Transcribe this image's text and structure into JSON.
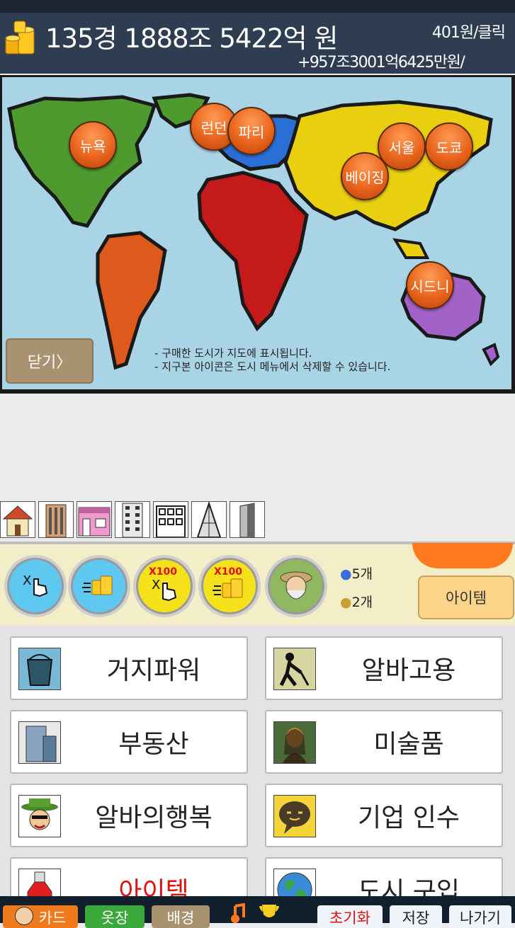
{
  "header": {
    "money": "135경 1888조 5422억 원",
    "per_click": "401원/클릭",
    "per_second": "+957조3001억6425만원/"
  },
  "map": {
    "cities": [
      "뉴욕",
      "런던",
      "파리",
      "서울",
      "도쿄",
      "베이징",
      "시드니"
    ],
    "close_label": "닫기〉",
    "hint_lines": [
      "- 구매한 도시가 지도에 표시됩니다.",
      "- 지구본 아이콘은 도시 메뉴에서 삭제할 수 있습니다."
    ]
  },
  "tools": {
    "x100_a": "X100",
    "x100_b": "X100",
    "potion_count": "5개",
    "bag_count": "2개",
    "item_button": "아이템"
  },
  "menu": [
    {
      "label": "거지파워",
      "icon": "bucket-icon"
    },
    {
      "label": "알바고용",
      "icon": "worker-icon"
    },
    {
      "label": "부동산",
      "icon": "building-icon"
    },
    {
      "label": "미술품",
      "icon": "painting-icon"
    },
    {
      "label": "알바의행복",
      "icon": "hat-man-icon"
    },
    {
      "label": "기업 인수",
      "icon": "speech-bubble-icon"
    },
    {
      "label": "아이템",
      "icon": "potion-icon"
    },
    {
      "label": "도시 구입",
      "icon": "globe-icon"
    }
  ],
  "bottom": {
    "card": "카드",
    "clothes": "옷장",
    "background": "배경",
    "reset": "초기화",
    "save": "저장",
    "exit": "나가기"
  },
  "colors": {
    "topbar": "#2e3d52",
    "tool_row": "#f3eec7",
    "item_button": "#fbd48a",
    "city_pin": "#e8641c",
    "menu_red": "#e01010"
  }
}
